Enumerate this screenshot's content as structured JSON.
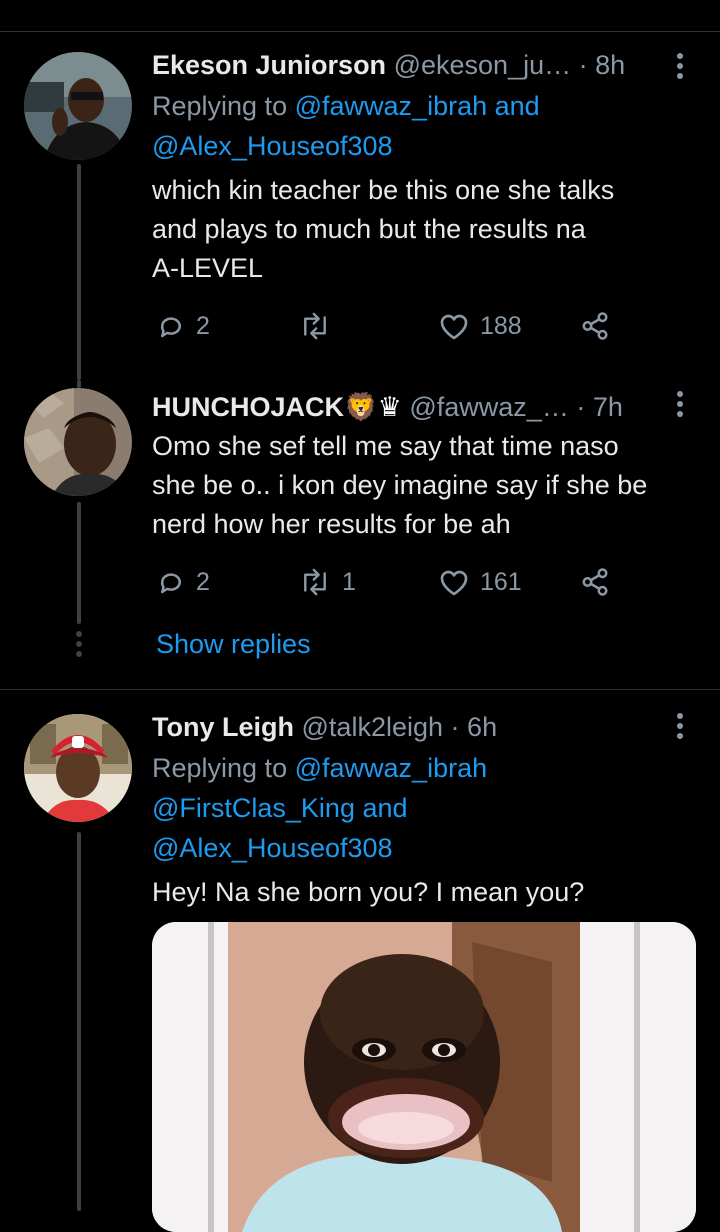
{
  "tweets": [
    {
      "name": "Ekeson Juniorson",
      "handle": "@ekeson_ju…",
      "time": "8h",
      "replying_prefix": "Replying to",
      "mentions": [
        "@fawwaz_ibrah",
        "@Alex_Houseof308"
      ],
      "conj": "and",
      "lines": [
        "which kin teacher be this one she talks",
        "and plays to much but the results na",
        "A-LEVEL"
      ],
      "replies": "2",
      "retweets": "",
      "likes": "188"
    },
    {
      "name": "HUNCHOJACK",
      "badges": "🦁♛",
      "handle": "@fawwaz_…",
      "time": "7h",
      "lines": [
        "Omo she sef tell me say that time naso",
        "she be o.. i kon dey imagine say if she be",
        "nerd how her results for be ah"
      ],
      "replies": "2",
      "retweets": "1",
      "likes": "161",
      "show_replies": "Show replies"
    },
    {
      "name": "Tony Leigh",
      "handle": "@talk2leigh",
      "time": "6h",
      "replying_prefix": "Replying to",
      "mentions": [
        "@fawwaz_ibrah",
        "@FirstClas_King",
        "@Alex_Houseof308"
      ],
      "conj": "and",
      "lines": [
        "Hey! Na she born you? I mean you?"
      ]
    }
  ],
  "separator_dot": "·",
  "colors": {
    "background": "#000000",
    "accent": "#1d9bf0",
    "muted": "#8b98a5",
    "text": "#e7e9ea"
  },
  "icons": [
    "reply-icon",
    "retweet-icon",
    "like-icon",
    "share-icon",
    "more-icon"
  ]
}
